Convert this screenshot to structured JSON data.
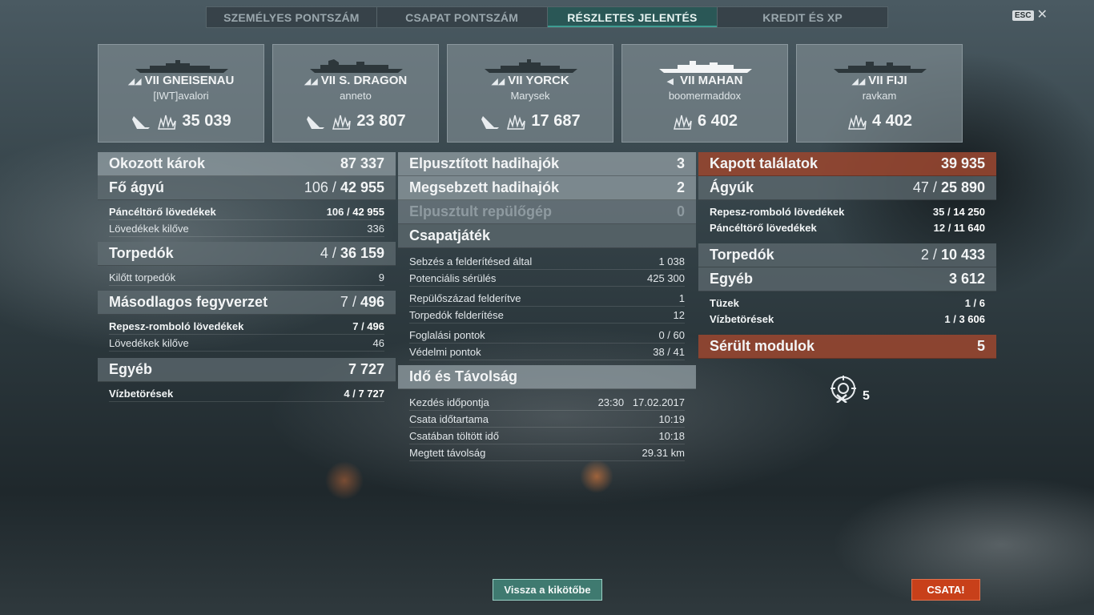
{
  "tabs": [
    {
      "label": "SZEMÉLYES PONTSZÁM",
      "active": false
    },
    {
      "label": "CSAPAT PONTSZÁM",
      "active": false
    },
    {
      "label": "RÉSZLETES JELENTÉS",
      "active": true
    },
    {
      "label": "KREDIT ÉS XP",
      "active": false
    }
  ],
  "esc": {
    "key": "ESC",
    "close": "✕"
  },
  "players": [
    {
      "tier": "VII",
      "ship": "GNEISENAU",
      "player": "[IWT]avalori",
      "score": "35 039",
      "sunk": true
    },
    {
      "tier": "VII",
      "ship": "S. DRAGON",
      "player": "anneto",
      "score": "23 807",
      "sunk": true
    },
    {
      "tier": "VII",
      "ship": "YORCK",
      "player": "Marysek",
      "score": "17 687",
      "sunk": true
    },
    {
      "tier": "VII",
      "ship": "MAHAN",
      "player": "boomermaddox",
      "score": "6 402",
      "sunk": false
    },
    {
      "tier": "VII",
      "ship": "FIJI",
      "player": "ravkam",
      "score": "4 402",
      "sunk": false
    }
  ],
  "damage": {
    "title": "Okozott károk",
    "total": "87 337",
    "main": {
      "label": "Fő ágyú",
      "hits": "106",
      "value": "42 955"
    },
    "main_rows": [
      {
        "label": "Páncéltörő lövedékek",
        "hits": "106",
        "value": "42 955"
      },
      {
        "label": "Lövedékek kilőve",
        "value": "336"
      }
    ],
    "torp": {
      "label": "Torpedók",
      "hits": "4",
      "value": "36 159"
    },
    "torp_rows": [
      {
        "label": "Kilőtt torpedók",
        "value": "9"
      }
    ],
    "secondary": {
      "label": "Másodlagos fegyverzet",
      "hits": "7",
      "value": "496"
    },
    "secondary_rows": [
      {
        "label": "Repesz-romboló lövedékek",
        "hits": "7",
        "value": "496"
      },
      {
        "label": "Lövedékek kilőve",
        "value": "46"
      }
    ],
    "other": {
      "label": "Egyéb",
      "value": "7 727"
    },
    "other_rows": [
      {
        "label": "Vízbetörések",
        "hits": "4",
        "value": "7 727"
      }
    ]
  },
  "middle": {
    "destroyed": {
      "label": "Elpusztított hadihajók",
      "value": "3"
    },
    "damaged": {
      "label": "Megsebzett hadihajók",
      "value": "2"
    },
    "planes": {
      "label": "Elpusztult repülőgép",
      "value": "0"
    },
    "team": {
      "label": "Csapatjáték"
    },
    "team_rows1": [
      {
        "label": "Sebzés a felderítésed által",
        "value": "1 038"
      },
      {
        "label": "Potenciális sérülés",
        "value": "425 300"
      }
    ],
    "team_rows2": [
      {
        "label": "Repülőszázad felderítve",
        "value": "1"
      },
      {
        "label": "Torpedók felderítése",
        "value": "12"
      }
    ],
    "team_rows3": [
      {
        "label": "Foglalási pontok",
        "value": "0 / 60"
      },
      {
        "label": "Védelmi pontok",
        "value": "38 / 41"
      }
    ],
    "time": {
      "label": "Idő és Távolság"
    },
    "time_rows": [
      {
        "label": "Kezdés időpontja",
        "value": "23:30   17.02.2017"
      },
      {
        "label": "Csata időtartama",
        "value": "10:19"
      },
      {
        "label": "Csatában töltött idő",
        "value": "10:18"
      },
      {
        "label": "Megtett távolság",
        "value": "29.31 km"
      }
    ]
  },
  "received": {
    "title": "Kapott találatok",
    "total": "39 935",
    "guns": {
      "label": "Ágyúk",
      "hits": "47",
      "value": "25 890"
    },
    "gun_rows": [
      {
        "label": "Repesz-romboló lövedékek",
        "hits": "35",
        "value": "14 250"
      },
      {
        "label": "Páncéltörő lövedékek",
        "hits": "12",
        "value": "11 640"
      }
    ],
    "torp": {
      "label": "Torpedók",
      "hits": "2",
      "value": "10 433"
    },
    "other": {
      "label": "Egyéb",
      "value": "3 612"
    },
    "other_rows": [
      {
        "label": "Tüzek",
        "hits": "1",
        "value": "6"
      },
      {
        "label": "Vízbetörések",
        "hits": "1",
        "value": "3 606"
      }
    ],
    "modules": {
      "label": "Sérült modulok",
      "value": "5"
    },
    "module_icon_count": "5"
  },
  "buttons": {
    "back": "Vissza a kikötőbe",
    "battle": "CSATA!"
  },
  "colors": {
    "accent": "#3e9d92",
    "battle": "#c8401a",
    "received_header": "#964630"
  }
}
